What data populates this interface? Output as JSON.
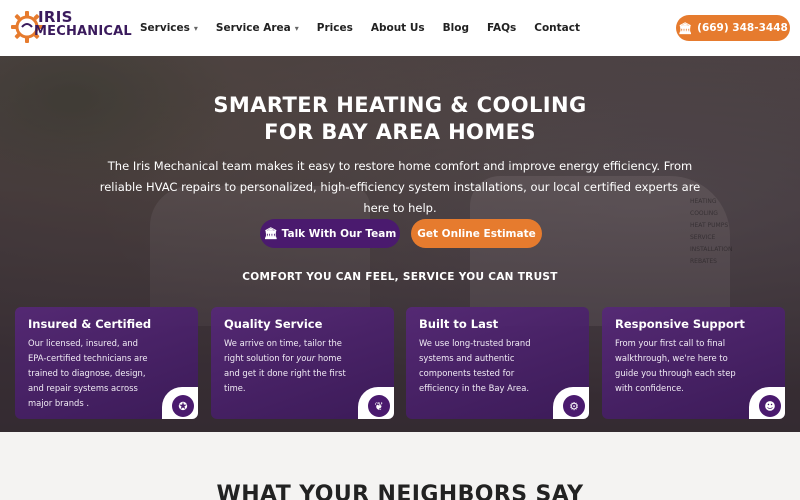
{
  "brand": {
    "line1": "IRIS",
    "line2": "MECHANICAL",
    "primary_color": "#3a1a5c",
    "accent_color": "#e67b2e"
  },
  "nav": {
    "items": [
      {
        "label": "Services",
        "has_dropdown": true
      },
      {
        "label": "Service Area",
        "has_dropdown": true
      },
      {
        "label": "Prices",
        "has_dropdown": false
      },
      {
        "label": "About Us",
        "has_dropdown": false
      },
      {
        "label": "Blog",
        "has_dropdown": false
      },
      {
        "label": "FAQs",
        "has_dropdown": false
      },
      {
        "label": "Contact",
        "has_dropdown": false
      }
    ],
    "phone": "(669) 348-3448",
    "phone_icon": "building-icon"
  },
  "hero": {
    "title_line1": "SMARTER HEATING & COOLING",
    "title_line2": "FOR BAY AREA HOMES",
    "subtitle": "The Iris Mechanical team makes it easy to restore home comfort and improve energy efficiency. From reliable HVAC repairs to personalized, high-efficiency system installations, our local certified experts are here to help.",
    "cta_talk": "Talk With Our Team",
    "cta_talk_icon": "building-icon",
    "cta_estimate": "Get Online Estimate",
    "tagline": "COMFORT YOU CAN FEEL, SERVICE YOU CAN TRUST",
    "van_text": [
      "HEATING",
      "COOLING",
      "HEAT PUMPS",
      "SERVICE",
      "INSTALLATION",
      "REBATES"
    ]
  },
  "cards": [
    {
      "title": "Insured & Certified",
      "body": "Our licensed, insured, and EPA-certified technicians are trained to diagnose, design, and repair systems across major brands .",
      "icon": "certificate-badge-icon",
      "glyph": "✪"
    },
    {
      "title": "Quality Service",
      "body_before": "We arrive on time, tailor the right solution for ",
      "body_em": "your",
      "body_after": " home and get it done right the first time.",
      "icon": "laurel-award-icon",
      "glyph": "❦"
    },
    {
      "title": "Built to Last",
      "body": "We use long-trusted brand systems and authentic components tested for efficiency in the Bay Area.",
      "icon": "gear-icon",
      "glyph": "⚙"
    },
    {
      "title": "Responsive Support",
      "body": "From your first call to final walkthrough, we're here to guide you through each step with confidence.",
      "icon": "team-people-icon",
      "glyph": "☻"
    }
  ],
  "reviews": {
    "title": "WHAT YOUR NEIGHBORS SAY"
  }
}
